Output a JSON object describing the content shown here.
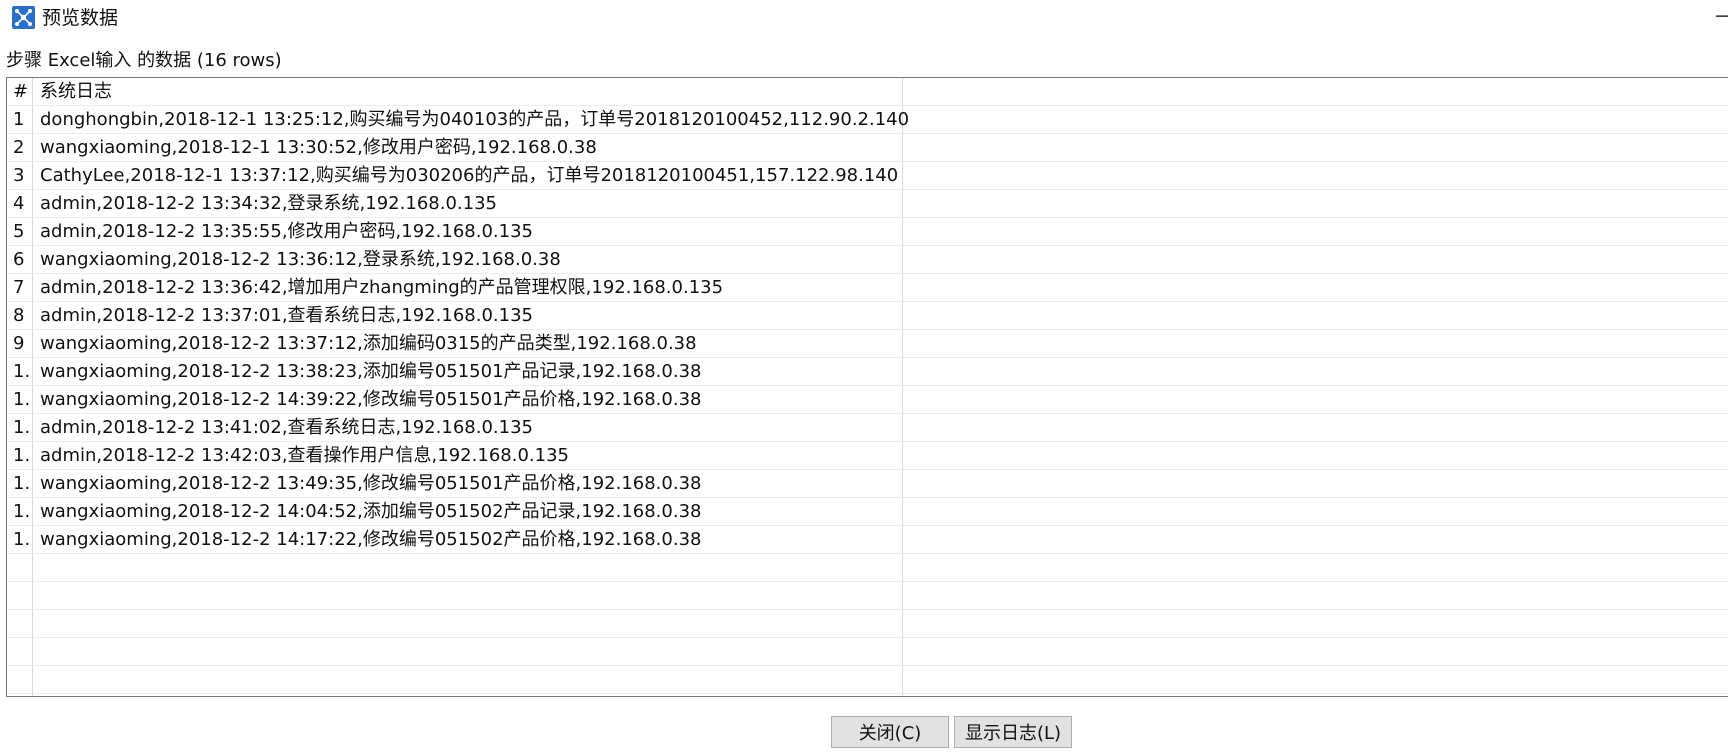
{
  "window": {
    "title": "预览数据",
    "minimize_symbol": "−"
  },
  "step_label": "步骤 Excel输入 的数据 (16 rows)",
  "grid": {
    "header_num": "#",
    "sort_indicator": "^",
    "column_header": "系统日志",
    "rows": [
      {
        "num": "1",
        "text": "donghongbin,2018-12-1 13:25:12,购买编号为040103的产品，订单号2018120100452,112.90.2.140"
      },
      {
        "num": "2",
        "text": "wangxiaoming,2018-12-1 13:30:52,修改用户密码,192.168.0.38"
      },
      {
        "num": "3",
        "text": "CathyLee,2018-12-1 13:37:12,购买编号为030206的产品，订单号2018120100451,157.122.98.140"
      },
      {
        "num": "4",
        "text": "admin,2018-12-2 13:34:32,登录系统,192.168.0.135"
      },
      {
        "num": "5",
        "text": "admin,2018-12-2 13:35:55,修改用户密码,192.168.0.135"
      },
      {
        "num": "6",
        "text": "wangxiaoming,2018-12-2 13:36:12,登录系统,192.168.0.38"
      },
      {
        "num": "7",
        "text": "admin,2018-12-2 13:36:42,增加用户zhangming的产品管理权限,192.168.0.135"
      },
      {
        "num": "8",
        "text": "admin,2018-12-2 13:37:01,查看系统日志,192.168.0.135"
      },
      {
        "num": "9",
        "text": "wangxiaoming,2018-12-2 13:37:12,添加编码0315的产品类型,192.168.0.38"
      },
      {
        "num": "1.",
        "text": "wangxiaoming,2018-12-2 13:38:23,添加编号051501产品记录,192.168.0.38"
      },
      {
        "num": "1.",
        "text": "wangxiaoming,2018-12-2 14:39:22,修改编号051501产品价格,192.168.0.38"
      },
      {
        "num": "1.",
        "text": "admin,2018-12-2 13:41:02,查看系统日志,192.168.0.135"
      },
      {
        "num": "1.",
        "text": "admin,2018-12-2 13:42:03,查看操作用户信息,192.168.0.135"
      },
      {
        "num": "1.",
        "text": "wangxiaoming,2018-12-2 13:49:35,修改编号051501产品价格,192.168.0.38"
      },
      {
        "num": "1.",
        "text": "wangxiaoming,2018-12-2 14:04:52,添加编号051502产品记录,192.168.0.38"
      },
      {
        "num": "1.",
        "text": "wangxiaoming,2018-12-2 14:17:22,修改编号051502产品价格,192.168.0.38"
      }
    ],
    "empty_rows": 5
  },
  "buttons": {
    "close": "关闭(C)",
    "show_log": "显示日志(L)"
  },
  "colors": {
    "icon_bg": "#2a6fc9",
    "button_bg": "#e1e1e1",
    "border": "#7a7a7a"
  }
}
